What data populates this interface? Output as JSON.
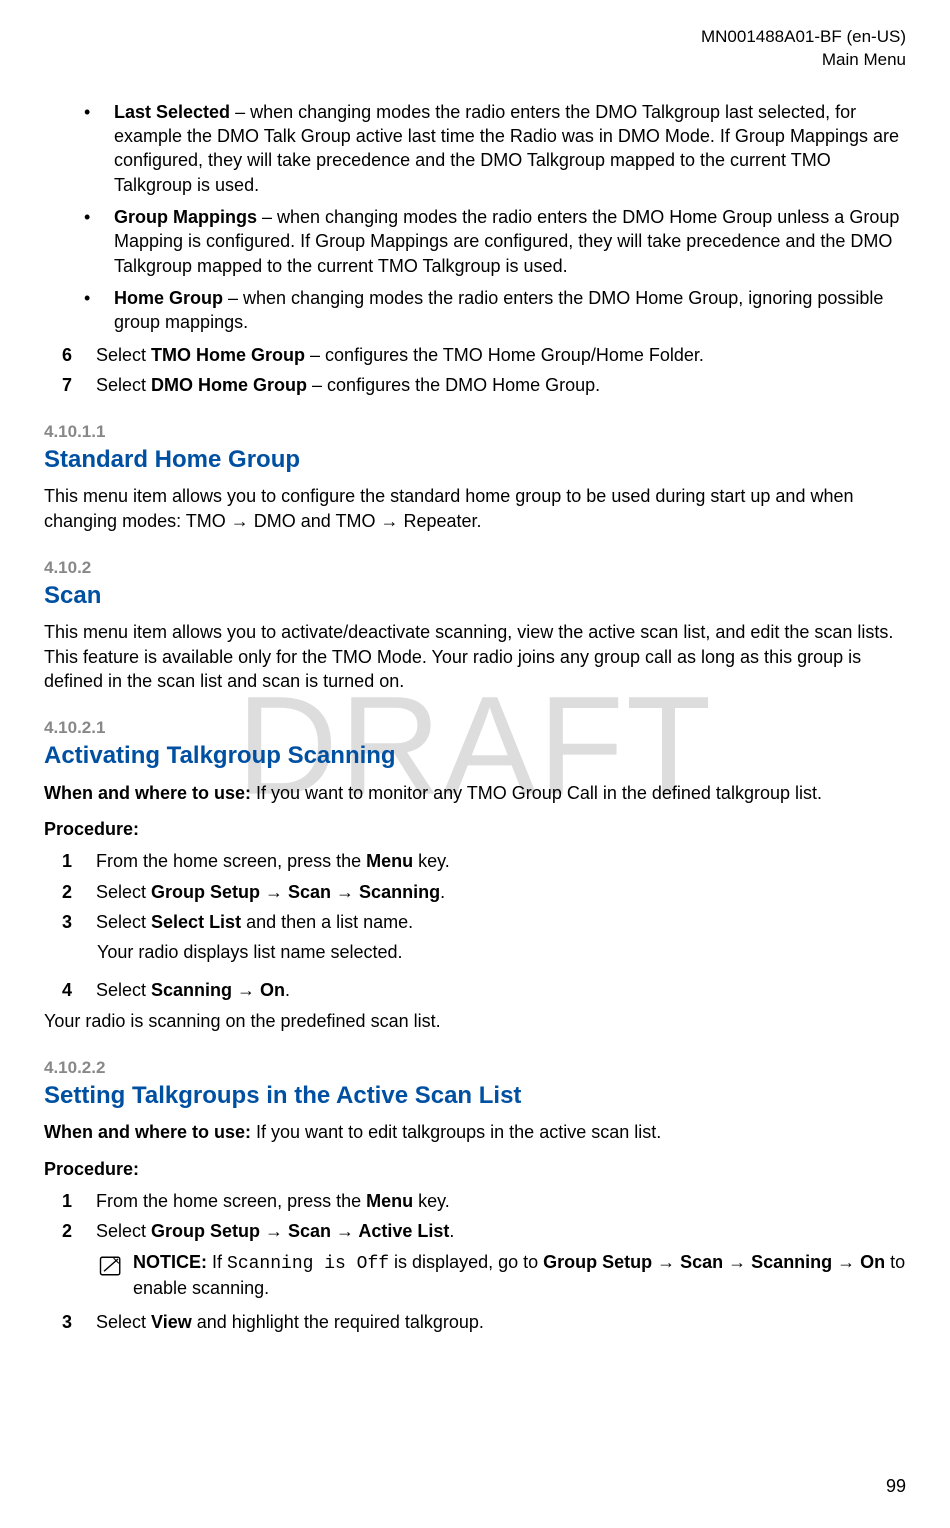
{
  "header": {
    "doc_id": "MN001488A01-BF (en-US)",
    "section": "Main Menu"
  },
  "watermark": "DRAFT",
  "bullets": {
    "b1_bold": "Last Selected",
    "b1_rest": " – when changing modes the radio enters the DMO Talkgroup last selected, for example the DMO Talk Group active last time the Radio was in DMO Mode. If Group Mappings are configured, they will take precedence and the DMO Talkgroup mapped to the current TMO Talkgroup is used.",
    "b2_bold": "Group Mappings",
    "b2_rest": " – when changing modes the radio enters the DMO Home Group unless a Group Mapping is configured. If Group Mappings are configured, they will take precedence and the DMO Talkgroup mapped to the current TMO Talkgroup is used.",
    "b3_bold": "Home Group",
    "b3_rest": " – when changing modes the radio enters the DMO Home Group, ignoring possible group mappings."
  },
  "num6": {
    "n": "6",
    "pre": "Select ",
    "bold": "TMO Home Group",
    "rest": " – configures the TMO Home Group/Home Folder."
  },
  "num7": {
    "n": "7",
    "pre": "Select ",
    "bold": "DMO Home Group",
    "rest": " – configures the DMO Home Group."
  },
  "s1": {
    "num": "4.10.1.1",
    "title": "Standard Home Group",
    "body": "This menu item allows you to configure the standard home group to be used during start up and when changing modes: TMO → DMO and TMO → Repeater."
  },
  "s2": {
    "num": "4.10.2",
    "title": "Scan",
    "body": "This menu item allows you to activate/deactivate scanning, view the active scan list, and edit the scan lists. This feature is available only for the TMO Mode. Your radio joins any group call as long as this group is defined in the scan list and scan is turned on."
  },
  "s3": {
    "num": "4.10.2.1",
    "title": "Activating Talkgroup Scanning",
    "whenlabel": "When and where to use:",
    "whenbody": " If you want to monitor any TMO Group Call in the defined talkgroup list.",
    "proc": "Procedure:",
    "p1": {
      "n": "1",
      "a": "From the home screen, press the ",
      "b": "Menu",
      "c": " key."
    },
    "p2": {
      "n": "2",
      "a": "Select ",
      "b": "Group Setup → Scan → Scanning",
      "c": "."
    },
    "p3": {
      "n": "3",
      "a": "Select ",
      "b": "Select List",
      "c": " and then a list name."
    },
    "p3r": "Your radio displays list name selected.",
    "p4": {
      "n": "4",
      "a": "Select ",
      "b": "Scanning → On",
      "c": "."
    },
    "result": "Your radio is scanning on the predefined scan list."
  },
  "s4": {
    "num": "4.10.2.2",
    "title": "Setting Talkgroups in the Active Scan List",
    "whenlabel": "When and where to use:",
    "whenbody": " If you want to edit talkgroups in the active scan list.",
    "proc": "Procedure:",
    "p1": {
      "n": "1",
      "a": "From the home screen, press the ",
      "b": "Menu",
      "c": " key."
    },
    "p2": {
      "n": "2",
      "a": "Select ",
      "b": "Group Setup → Scan → Active List",
      "c": "."
    },
    "notice_bold": "NOTICE:",
    "notice_a": " If ",
    "notice_code": "Scanning is Off",
    "notice_b": " is displayed, go to ",
    "notice_bold2": "Group Setup → Scan → Scanning → On",
    "notice_c": " to enable scanning.",
    "p3": {
      "n": "3",
      "a": "Select ",
      "b": "View",
      "c": " and highlight the required talkgroup."
    }
  },
  "page_number": "99"
}
